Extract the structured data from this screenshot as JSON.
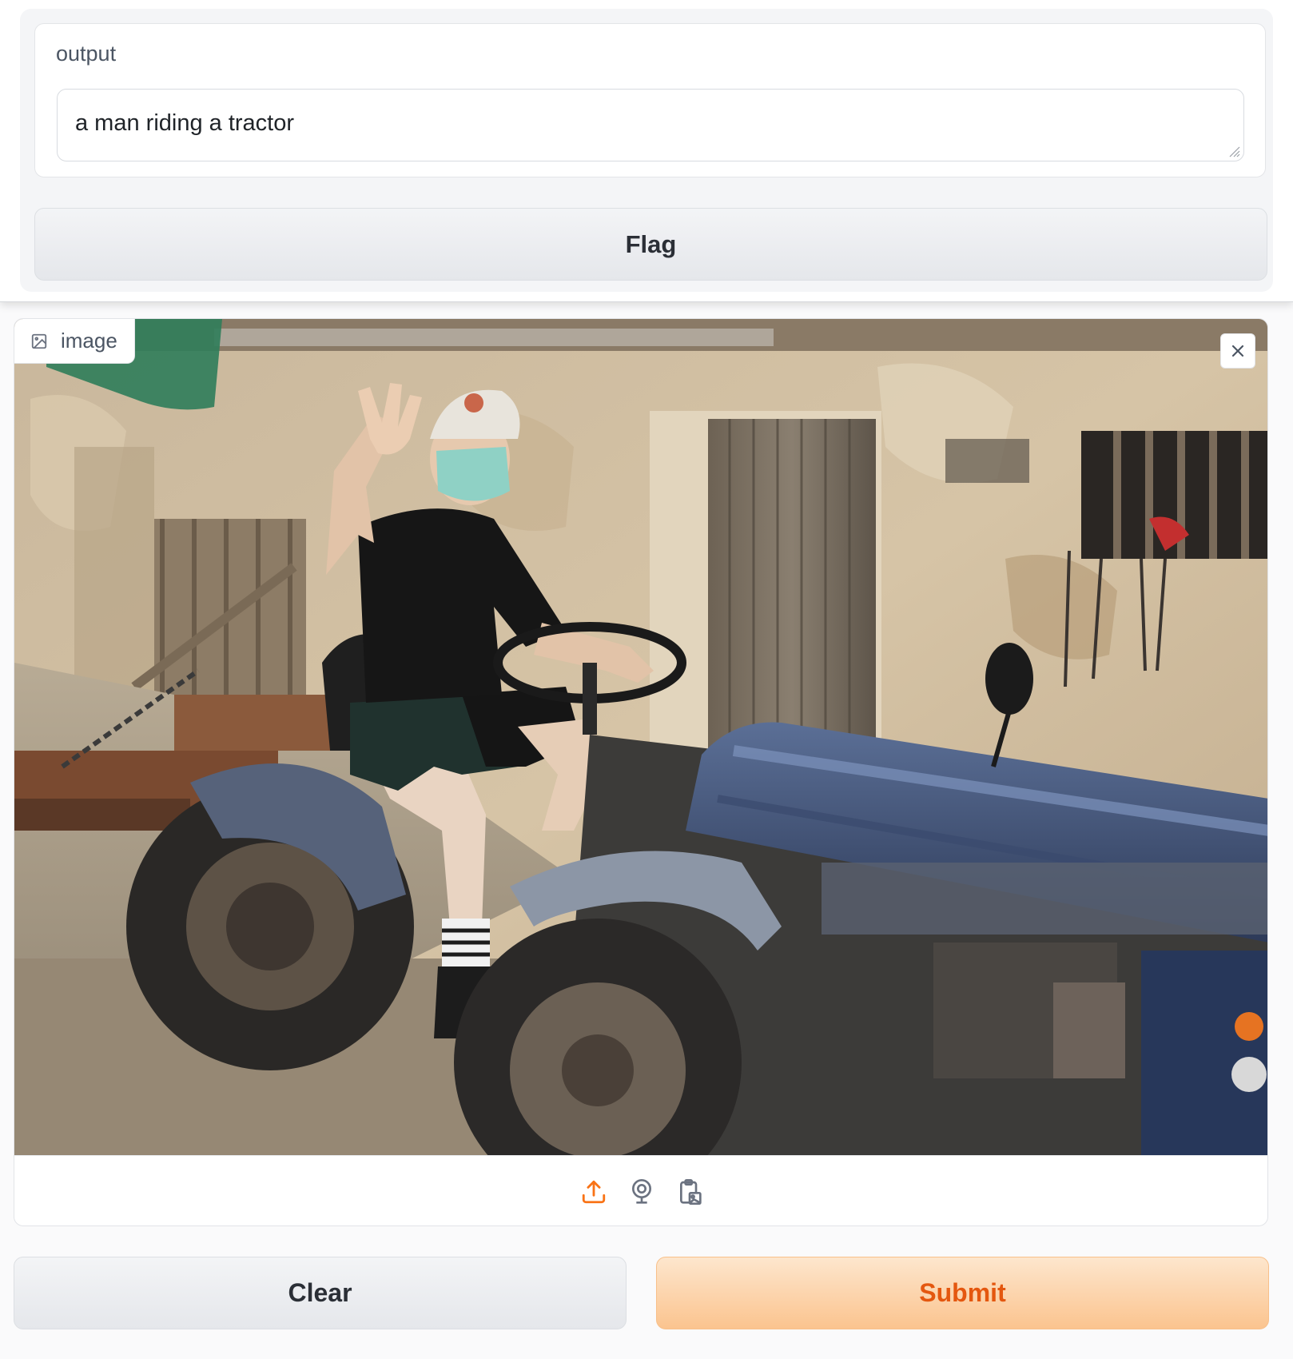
{
  "output": {
    "label": "output",
    "value": "a man riding a tractor"
  },
  "flag": {
    "label": "Flag"
  },
  "image_input": {
    "label": "image",
    "label_icon": "image-icon",
    "close_icon": "close-icon",
    "sources": [
      {
        "name": "upload-icon",
        "color": "#f97316"
      },
      {
        "name": "webcam-icon",
        "color": "#6b7280"
      },
      {
        "name": "clipboard-icon",
        "color": "#6b7280"
      }
    ]
  },
  "actions": {
    "clear_label": "Clear",
    "submit_label": "Submit",
    "submit_text_color": "#e4570f"
  }
}
